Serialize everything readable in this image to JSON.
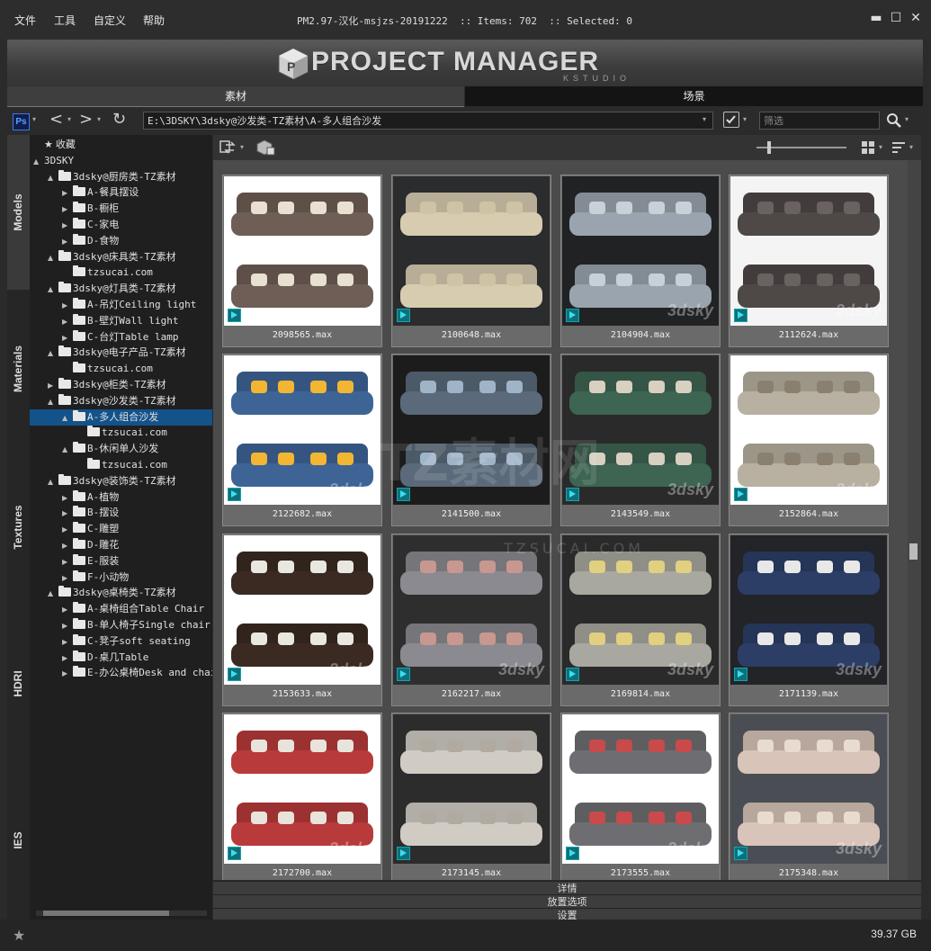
{
  "menu": [
    "文件",
    "工具",
    "自定义",
    "帮助"
  ],
  "title": "PM2.97-汉化-msjzs-20191222  :: Items: 702  :: Selected: 0",
  "window_buttons": {
    "minimize": "▬",
    "maximize": "☐",
    "close": "✕"
  },
  "banner": {
    "title": "PROJECT MANAGER",
    "subtitle": "KSTUDIO"
  },
  "main_tabs": [
    {
      "label": "素材",
      "active": true
    },
    {
      "label": "场景",
      "active": false
    }
  ],
  "toolbar": {
    "ps_label": "Ps",
    "back": "<",
    "forward": ">",
    "refresh": "↻",
    "path": "E:\\3DSKY\\3dsky@沙发类-TZ素材\\A-多人组合沙发",
    "filter_placeholder": "筛选"
  },
  "side_tabs": [
    "Models",
    "Materials",
    "Textures",
    "HDRI",
    "IES"
  ],
  "tree": [
    {
      "label": "收藏",
      "level": 0,
      "icon": "star",
      "tri": ""
    },
    {
      "label": "3DSKY",
      "level": 0,
      "icon": "none",
      "tri": "▲"
    },
    {
      "label": "3dsky@厨房类-TZ素材",
      "level": 1,
      "icon": "folder",
      "tri": "▲"
    },
    {
      "label": "A-餐具摆设",
      "level": 2,
      "icon": "folder",
      "tri": "▶"
    },
    {
      "label": "B-橱柜",
      "level": 2,
      "icon": "folder",
      "tri": "▶"
    },
    {
      "label": "C-家电",
      "level": 2,
      "icon": "folder",
      "tri": "▶"
    },
    {
      "label": "D-食物",
      "level": 2,
      "icon": "folder",
      "tri": "▶"
    },
    {
      "label": "3dsky@床具类-TZ素材",
      "level": 1,
      "icon": "folder",
      "tri": "▲"
    },
    {
      "label": "tzsucai.com",
      "level": 2,
      "icon": "folder",
      "tri": ""
    },
    {
      "label": "3dsky@灯具类-TZ素材",
      "level": 1,
      "icon": "folder",
      "tri": "▲"
    },
    {
      "label": "A-吊灯Ceiling light",
      "level": 2,
      "icon": "folder",
      "tri": "▶"
    },
    {
      "label": "B-壁灯Wall light",
      "level": 2,
      "icon": "folder",
      "tri": "▶"
    },
    {
      "label": "C-台灯Table lamp",
      "level": 2,
      "icon": "folder",
      "tri": "▶"
    },
    {
      "label": "3dsky@电子产品-TZ素材",
      "level": 1,
      "icon": "folder",
      "tri": "▲"
    },
    {
      "label": "tzsucai.com",
      "level": 2,
      "icon": "folder",
      "tri": ""
    },
    {
      "label": "3dsky@柜类-TZ素材",
      "level": 1,
      "icon": "folder",
      "tri": "▶"
    },
    {
      "label": "3dsky@沙发类-TZ素材",
      "level": 1,
      "icon": "folder",
      "tri": "▲"
    },
    {
      "label": "A-多人组合沙发",
      "level": 2,
      "icon": "folder",
      "tri": "▲",
      "selected": true
    },
    {
      "label": "tzsucai.com",
      "level": 3,
      "icon": "folder",
      "tri": ""
    },
    {
      "label": "B-休闲单人沙发",
      "level": 2,
      "icon": "folder",
      "tri": "▲"
    },
    {
      "label": "tzsucai.com",
      "level": 3,
      "icon": "folder",
      "tri": ""
    },
    {
      "label": "3dsky@装饰类-TZ素材",
      "level": 1,
      "icon": "folder",
      "tri": "▲"
    },
    {
      "label": "A-植物",
      "level": 2,
      "icon": "folder",
      "tri": "▶"
    },
    {
      "label": "B-摆设",
      "level": 2,
      "icon": "folder",
      "tri": "▶"
    },
    {
      "label": "C-雕塑",
      "level": 2,
      "icon": "folder",
      "tri": "▶"
    },
    {
      "label": "D-雕花",
      "level": 2,
      "icon": "folder",
      "tri": "▶"
    },
    {
      "label": "E-服装",
      "level": 2,
      "icon": "folder",
      "tri": "▶"
    },
    {
      "label": "F-小动物",
      "level": 2,
      "icon": "folder",
      "tri": "▶"
    },
    {
      "label": "3dsky@桌椅类-TZ素材",
      "level": 1,
      "icon": "folder",
      "tri": "▲"
    },
    {
      "label": "A-桌椅组合Table Chair",
      "level": 2,
      "icon": "folder",
      "tri": "▶"
    },
    {
      "label": "B-单人椅子Single chair",
      "level": 2,
      "icon": "folder",
      "tri": "▶"
    },
    {
      "label": "C-凳子soft seating",
      "level": 2,
      "icon": "folder",
      "tri": "▶"
    },
    {
      "label": "D-桌几Table",
      "level": 2,
      "icon": "folder",
      "tri": "▶"
    },
    {
      "label": "E-办公桌椅Desk and chair",
      "level": 2,
      "icon": "folder",
      "tri": "▶"
    }
  ],
  "items": [
    {
      "name": "2098565.max",
      "bg": "#ffffff",
      "sofa": "#6e5e55",
      "pillow": "#e8e0d0",
      "wm": ""
    },
    {
      "name": "2100648.max",
      "bg": "#2a2c2e",
      "sofa": "#d8ccb0",
      "pillow": "#cfc3a6",
      "wm": ""
    },
    {
      "name": "2104904.max",
      "bg": "#202224",
      "sofa": "#9aa4ae",
      "pillow": "#c8d0d8",
      "wm": "3dsky"
    },
    {
      "name": "2112624.max",
      "bg": "#f4f4f4",
      "sofa": "#4e4846",
      "pillow": "#6a6260",
      "wm": "3dsky"
    },
    {
      "name": "2122682.max",
      "bg": "#ffffff",
      "sofa": "#3e6496",
      "pillow": "#f2b632",
      "wm": "3dsky"
    },
    {
      "name": "2141500.max",
      "bg": "#1c1c1c",
      "sofa": "#5a6a7a",
      "pillow": "#a0b4c8",
      "wm": ""
    },
    {
      "name": "2143549.max",
      "bg": "#2a2a2a",
      "sofa": "#3e6452",
      "pillow": "#d8d0c0",
      "wm": "3dsky"
    },
    {
      "name": "2152864.max",
      "bg": "#ffffff",
      "sofa": "#b8b0a0",
      "pillow": "#8a8070",
      "wm": "3dsky"
    },
    {
      "name": "2153633.max",
      "bg": "#ffffff",
      "sofa": "#3a2a22",
      "pillow": "#e8e8e0",
      "wm": "3dsky"
    },
    {
      "name": "2162217.max",
      "bg": "#2e2e2e",
      "sofa": "#8a8a90",
      "pillow": "#c89890",
      "wm": "3dsky"
    },
    {
      "name": "2169814.max",
      "bg": "#2a2a2a",
      "sofa": "#a8a8a0",
      "pillow": "#e0d080",
      "wm": "3dsky"
    },
    {
      "name": "2171139.max",
      "bg": "#222428",
      "sofa": "#2c3e66",
      "pillow": "#e8e8e8",
      "wm": "3dsky"
    },
    {
      "name": "2172700.max",
      "bg": "#ffffff",
      "sofa": "#b83a3a",
      "pillow": "#e8e4dc",
      "wm": "3dsky"
    },
    {
      "name": "2173145.max",
      "bg": "#2c2c2c",
      "sofa": "#d0ccc4",
      "pillow": "#b0aaa0",
      "wm": ""
    },
    {
      "name": "2173555.max",
      "bg": "#ffffff",
      "sofa": "#6e6e72",
      "pillow": "#c84a4a",
      "wm": "3dsky"
    },
    {
      "name": "2175348.max",
      "bg": "#4a4e54",
      "sofa": "#d8c4b8",
      "pillow": "#e8dcd0",
      "wm": "3dsky"
    }
  ],
  "bottom_panels": [
    "详情",
    "放置选项",
    "设置"
  ],
  "status": {
    "free_space": "39.37 GB"
  },
  "watermark": {
    "main": "TZ素材网",
    "sub": "TZSUCAI.COM"
  }
}
